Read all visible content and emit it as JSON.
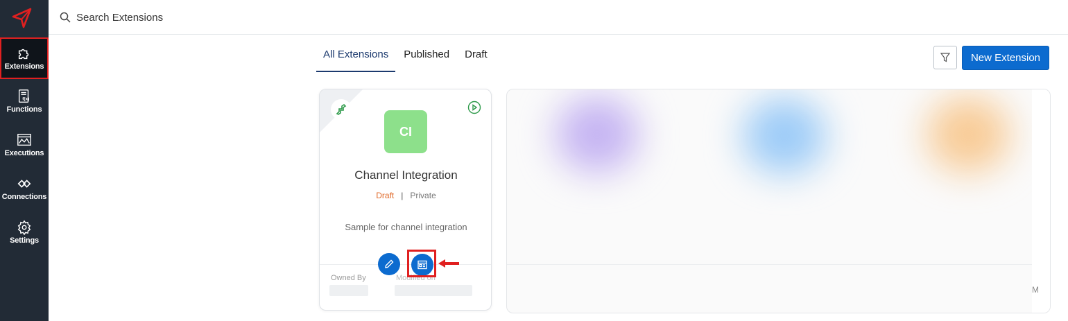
{
  "sidebar": {
    "items": [
      {
        "label": "Extensions",
        "icon": "puzzle-icon"
      },
      {
        "label": "Functions",
        "icon": "function-icon"
      },
      {
        "label": "Executions",
        "icon": "executions-icon"
      },
      {
        "label": "Connections",
        "icon": "connections-icon"
      },
      {
        "label": "Settings",
        "icon": "gear-icon"
      }
    ]
  },
  "search": {
    "placeholder": "Search Extensions"
  },
  "tabs": [
    {
      "label": "All Extensions",
      "active": true
    },
    {
      "label": "Published"
    },
    {
      "label": "Draft"
    }
  ],
  "toolbar": {
    "new_label": "New Extension"
  },
  "card": {
    "avatar": "CI",
    "title": "Channel Integration",
    "status": "Draft",
    "separator": "|",
    "visibility": "Private",
    "description": "Sample for channel integration",
    "owned_by_label": "Owned By",
    "modified_on_label": "Modified on"
  },
  "blurred": {
    "fragment": "M"
  },
  "colors": {
    "sidebar": "#222b36",
    "accent": "#0c6bcf",
    "avatar_bg": "#8de08b",
    "draft": "#e06a2a",
    "highlight": "#e02020"
  }
}
